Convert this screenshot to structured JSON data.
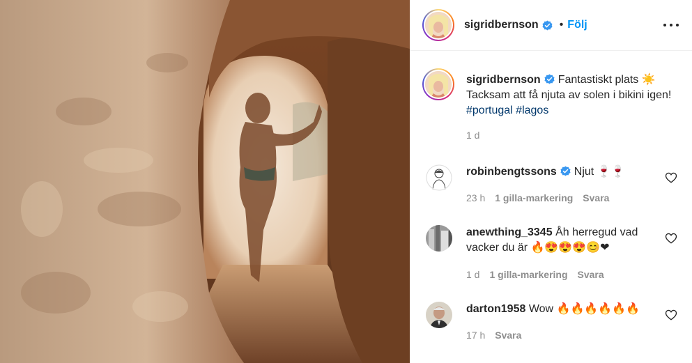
{
  "post": {
    "author": "sigridbernson",
    "verified": true,
    "follow_label": "Följ",
    "caption_text": "Fantastiskt plats ☀️ Tacksam att få njuta av solen i bikini igen! ",
    "hashtags": [
      "#portugal",
      "#lagos"
    ],
    "age": "1 d"
  },
  "icons": {
    "verified": "verified-badge-icon",
    "more": "more-options-icon",
    "like": "heart-icon"
  },
  "colors": {
    "accent": "#0095f6",
    "hashtag": "#00376b",
    "muted": "#8e8e8e",
    "verified": "#3897f0"
  },
  "comments": [
    {
      "username": "robinbengtssons",
      "verified": true,
      "text": "Njut 🍷🍷",
      "age": "23 h",
      "likes": "1 gilla-markering",
      "reply": "Svara"
    },
    {
      "username": "anewthing_3345",
      "verified": false,
      "text": "Åh herregud vad vacker du är 🔥😍😍😍😊❤",
      "age": "1 d",
      "likes": "1 gilla-markering",
      "reply": "Svara"
    },
    {
      "username": "darton1958",
      "verified": false,
      "text": "Wow 🔥🔥🔥🔥🔥🔥",
      "age": "17 h",
      "likes": "",
      "reply": "Svara"
    }
  ]
}
